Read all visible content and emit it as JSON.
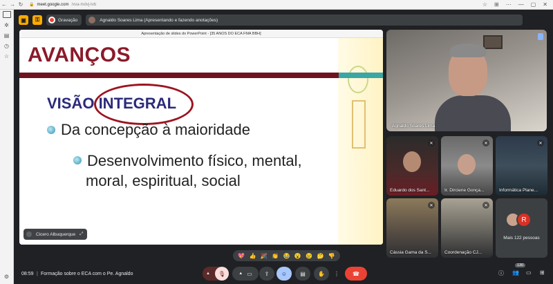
{
  "browser": {
    "url_host": "meet.google.com",
    "url_path": "/xva-mdvj-tvb",
    "nav": [
      "←",
      "→",
      "↻"
    ],
    "right_icons": [
      "☆",
      "⊞",
      "⋯",
      "—",
      "▢",
      "✕"
    ]
  },
  "topbar": {
    "recording_label": "Gravação",
    "presenter_text": "Agnaldo Soares Lima (Apresentando e fazendo anotações)"
  },
  "presentation": {
    "window_title": "Apresentação de slides do PowerPoint - [35 ANOS DO ECA FMA BBH]",
    "heading": "AVANÇOS",
    "subheading": "VISÃO INTEGRAL",
    "bullet1": "Da concepção à maioridade",
    "bullet2_line1": "Desenvolvimento físico, mental,",
    "bullet2_line2": "moral, espiritual, social",
    "presenter_name": "Cicero Albuquerque"
  },
  "tiles": {
    "main_speaker": "Agnaldo Soares Lima",
    "t1": "Eduardo dos Sant...",
    "t2": "Ir. Dirciene Gonça...",
    "t3": "Informática Plane...",
    "t4": "Cássia Gama da S...",
    "t5": "Coordenação CJ...",
    "more_avatar_letter": "R",
    "more_people": "Mais 122 pessoas"
  },
  "reactions": [
    "💖",
    "👍",
    "🎉",
    "👏",
    "😂",
    "😮",
    "😢",
    "🤔",
    "👎"
  ],
  "bottom": {
    "time": "08:59",
    "separator": "|",
    "meeting_name": "Formação sobre o ECA com o Pe. Agnaldo",
    "participants_count": "130"
  },
  "colors": {
    "accent_red": "#ea4335",
    "accent_blue": "#a8c7fa",
    "slide_heading": "#8b1a2a",
    "slide_sub": "#2b2a7a"
  }
}
